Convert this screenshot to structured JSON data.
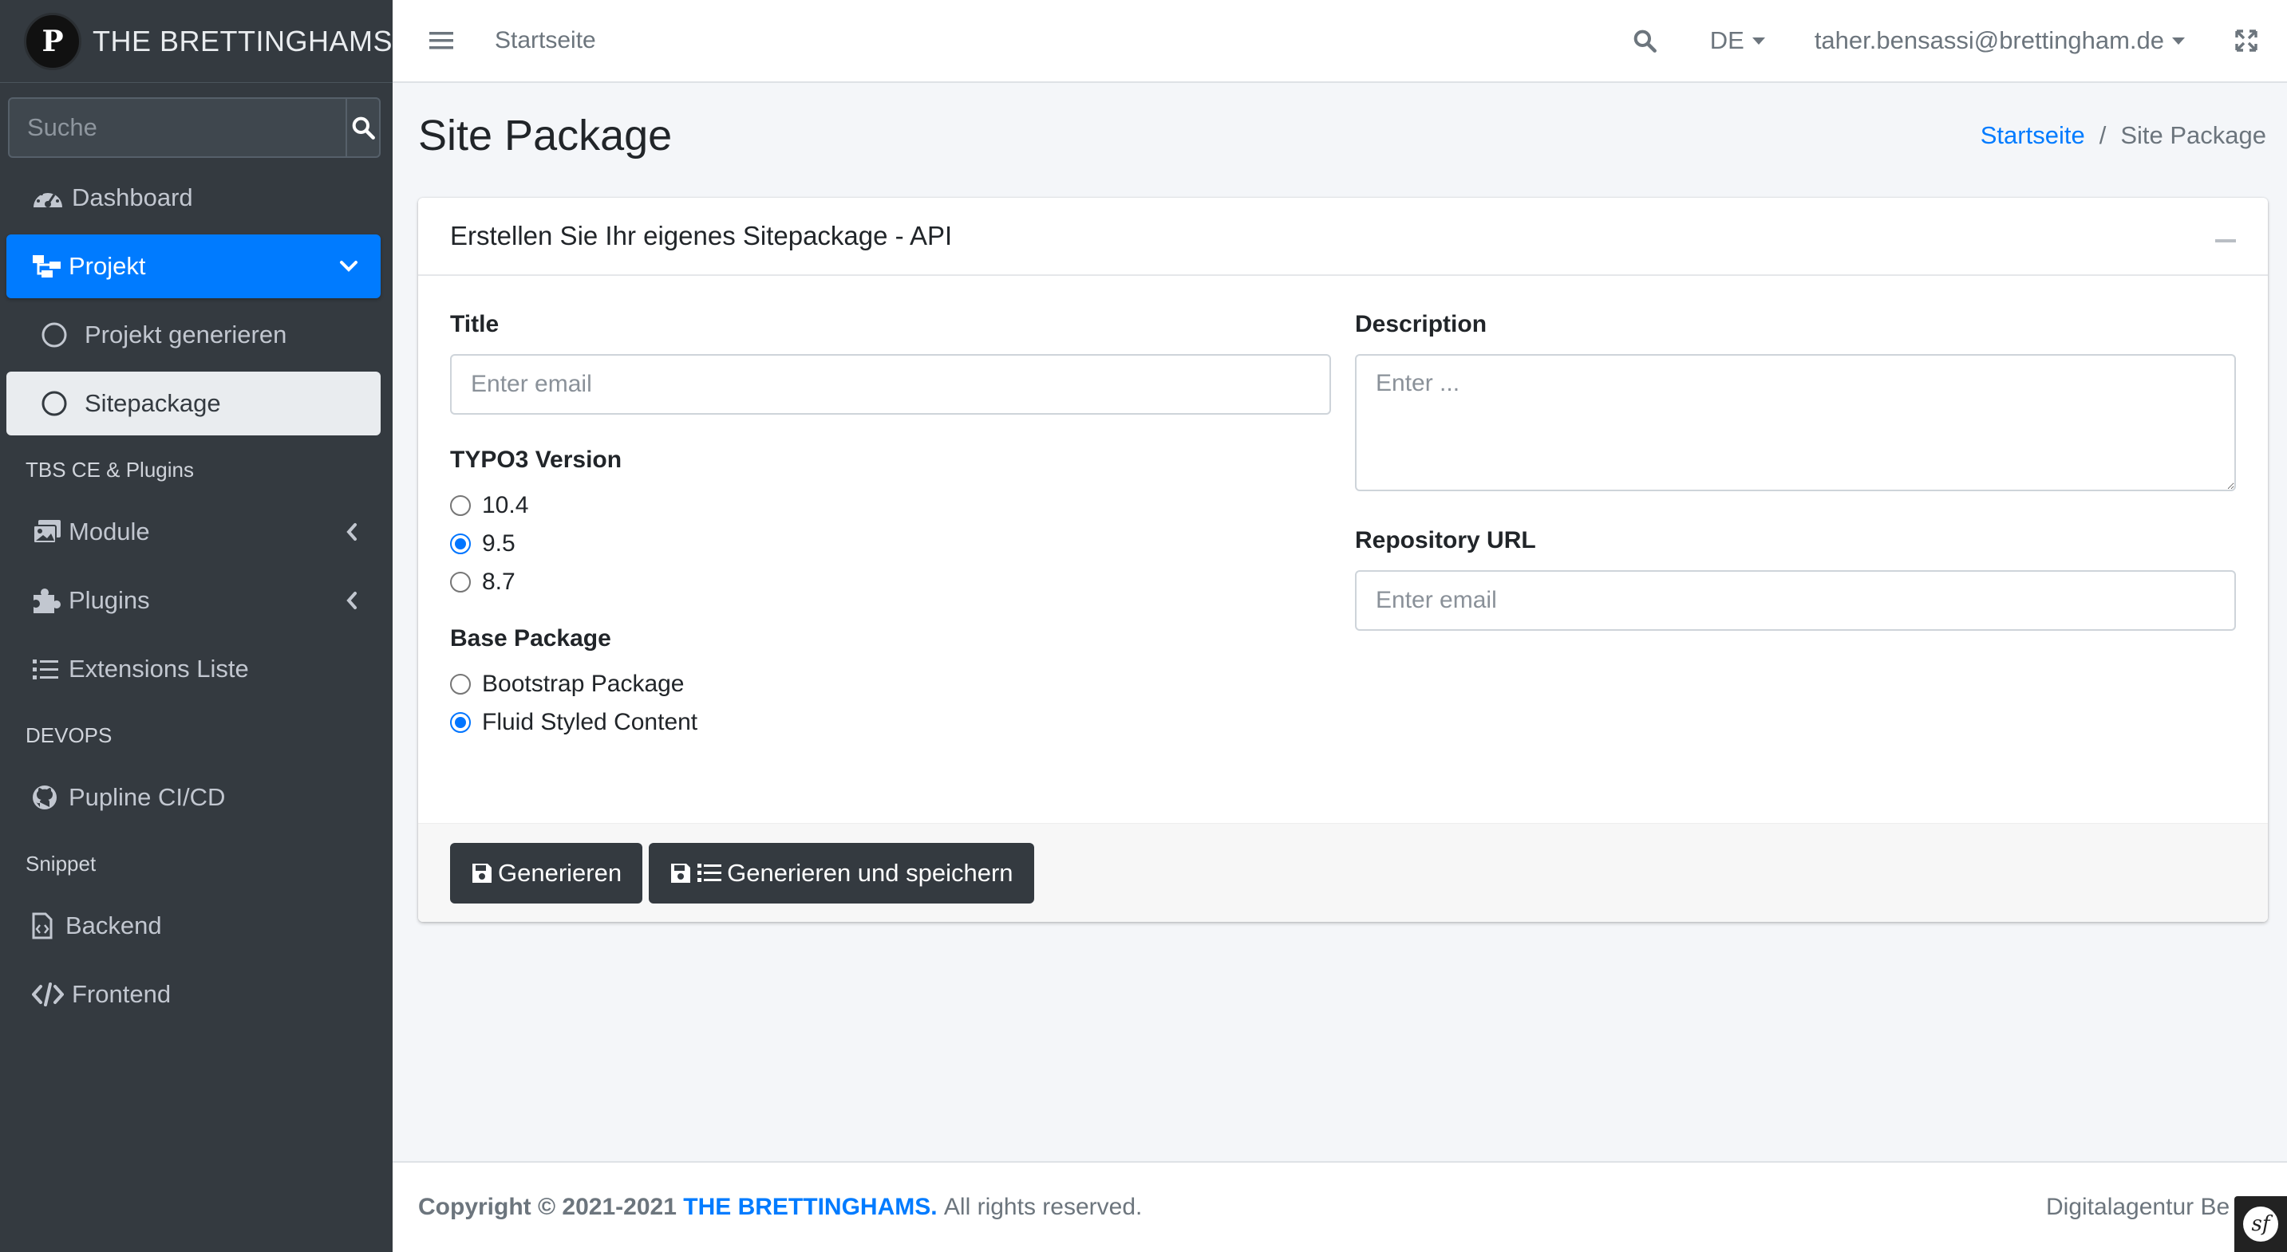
{
  "sidebar": {
    "brand_logo_text": "P",
    "brand_name": "THE BRETTINGHAMS",
    "search_placeholder": "Suche",
    "items": [
      {
        "label": "Dashboard",
        "icon": "tachometer-icon"
      },
      {
        "label": "Projekt",
        "icon": "sitemap-icon",
        "active": true
      },
      {
        "label": "Projekt generieren",
        "icon": "circle-icon"
      },
      {
        "label": "Sitepackage",
        "icon": "circle-icon",
        "selected": true
      }
    ],
    "headers": {
      "tbs": "TBS CE & Plugins",
      "devops": "DEVOPS",
      "snippet": "Snippet"
    },
    "tbs_items": [
      {
        "label": "Module",
        "icon": "images-icon"
      },
      {
        "label": "Plugins",
        "icon": "puzzle-icon"
      },
      {
        "label": "Extensions Liste",
        "icon": "list-icon"
      }
    ],
    "devops_items": [
      {
        "label": "Pupline CI/CD",
        "icon": "github-icon"
      }
    ],
    "snippet_items": [
      {
        "label": "Backend",
        "icon": "file-code-icon"
      },
      {
        "label": "Frontend",
        "icon": "code-icon"
      }
    ]
  },
  "topbar": {
    "home_link": "Startseite",
    "language": "DE",
    "user": "taher.bensassi@brettingham.de"
  },
  "page": {
    "title": "Site Package",
    "breadcrumb": {
      "home": "Startseite",
      "separator": "/",
      "current": "Site Package"
    }
  },
  "card": {
    "title": "Erstellen Sie Ihr eigenes Sitepackage - API",
    "title_field": {
      "label": "Title",
      "placeholder": "Enter email"
    },
    "typo3": {
      "label": "TYPO3 Version",
      "options": [
        "10.4",
        "9.5",
        "8.7"
      ],
      "selected": "9.5"
    },
    "base_package": {
      "label": "Base Package",
      "options": [
        "Bootstrap Package",
        "Fluid Styled Content"
      ],
      "selected": "Fluid Styled Content"
    },
    "description": {
      "label": "Description",
      "placeholder": "Enter ..."
    },
    "repository": {
      "label": "Repository URL",
      "placeholder": "Enter email"
    },
    "buttons": {
      "generate": "Generieren",
      "generate_save": "Generieren und speichern"
    }
  },
  "footer": {
    "copyright": "Copyright © 2021-2021",
    "brand": "THE BRETTINGHAMS.",
    "rights": "All rights reserved.",
    "right_text": "Digitalagentur Be"
  },
  "colors": {
    "accent": "#007bff",
    "sidebar_bg": "#343a40",
    "button_dark": "#343a40"
  }
}
